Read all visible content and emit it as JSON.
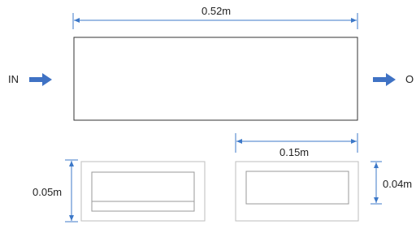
{
  "labels": {
    "inlet": "IN",
    "outlet": "O",
    "length": "0.52m",
    "width": "0.15m",
    "height_left": "0.05m",
    "height_right": "0.04m"
  },
  "colors": {
    "dimension_line": "#3c78c8",
    "flow_arrow": "#3f72c4",
    "outline": "#333333",
    "inner_outline": "#9a9a9a"
  }
}
